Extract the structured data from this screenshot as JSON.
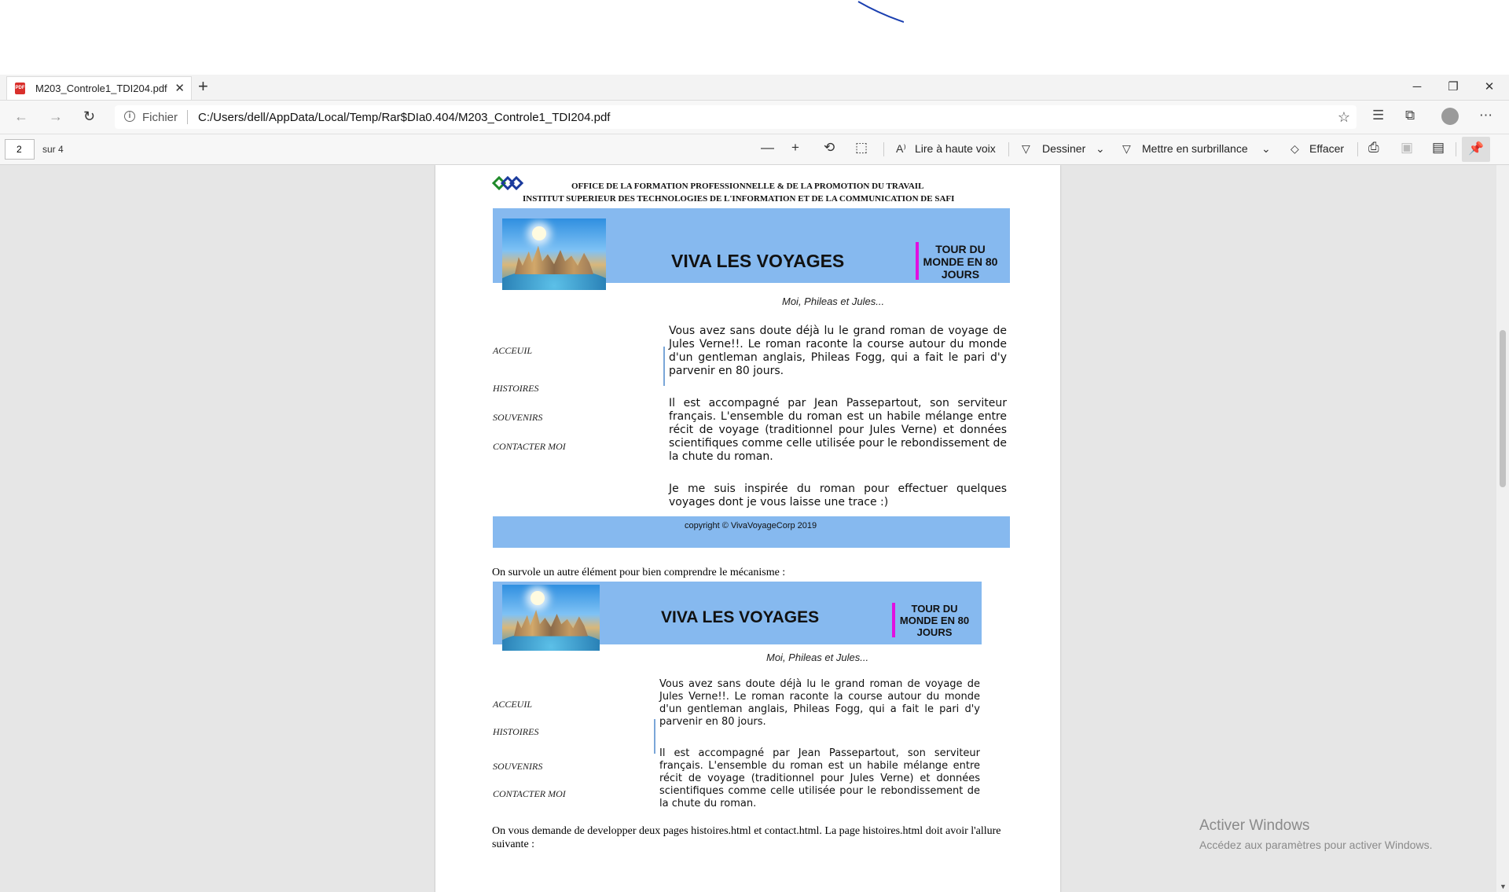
{
  "browser": {
    "tab_title": "M203_Controle1_TDI204.pdf",
    "url_scheme": "Fichier",
    "url": "C:/Users/dell/AppData/Local/Temp/Rar$DIa0.404/M203_Controle1_TDI204.pdf"
  },
  "pdf_toolbar": {
    "page_number": "2",
    "page_total": "sur 4",
    "read_aloud": "Lire à haute voix",
    "draw": "Dessiner",
    "highlight": "Mettre en surbrillance",
    "erase": "Effacer"
  },
  "document": {
    "header_line1": "OFFICE DE LA FORMATION PROFESSIONNELLE & DE LA PROMOTION DU TRAVAIL",
    "header_line2": "INSTITUT SUPERIEUR DES TECHNOLOGIES DE L'INFORMATION ET DE LA COMMUNICATION DE SAFI",
    "banner_title": "VIVA LES VOYAGES",
    "banner_tour": "TOUR DU MONDE EN 80 JOURS",
    "subtitle": "Moi, Phileas et Jules...",
    "nav": [
      "ACCEUIL",
      "HISTOIRES",
      "SOUVENIRS",
      "CONTACTER MOI"
    ],
    "paragraphs": [
      "Vous avez sans doute déjà lu le grand roman de voyage de Jules Verne!!. Le roman raconte la course autour du monde d'un gentleman anglais, Phileas Fogg, qui a fait le pari d'y parvenir en 80 jours.",
      "Il est accompagné par Jean Passepartout, son serviteur français. L'ensemble du roman est un habile mélange entre récit de voyage (traditionnel pour Jules Verne) et données scientifiques comme celle utilisée pour le rebondissement de la chute du roman.",
      "Je me suis inspirée du roman pour effectuer quelques voyages dont je vous laisse une trace :)"
    ],
    "copyright": "copyright © VivaVoyageCorp 2019",
    "hover_intro": "On survole un autre élément pour bien comprendre le mécanisme :",
    "task_text": "On vous demande de developper deux pages histoires.html et contact.html. La page histoires.html doit avoir l'allure suivante :"
  },
  "watermark": {
    "title": "Activer Windows",
    "subtitle": "Accédez aux paramètres pour activer Windows."
  },
  "colors": {
    "banner_blue": "#86b9ef",
    "tour_bar_magenta": "#e010e0",
    "pdf_icon_red": "#d9302c"
  }
}
